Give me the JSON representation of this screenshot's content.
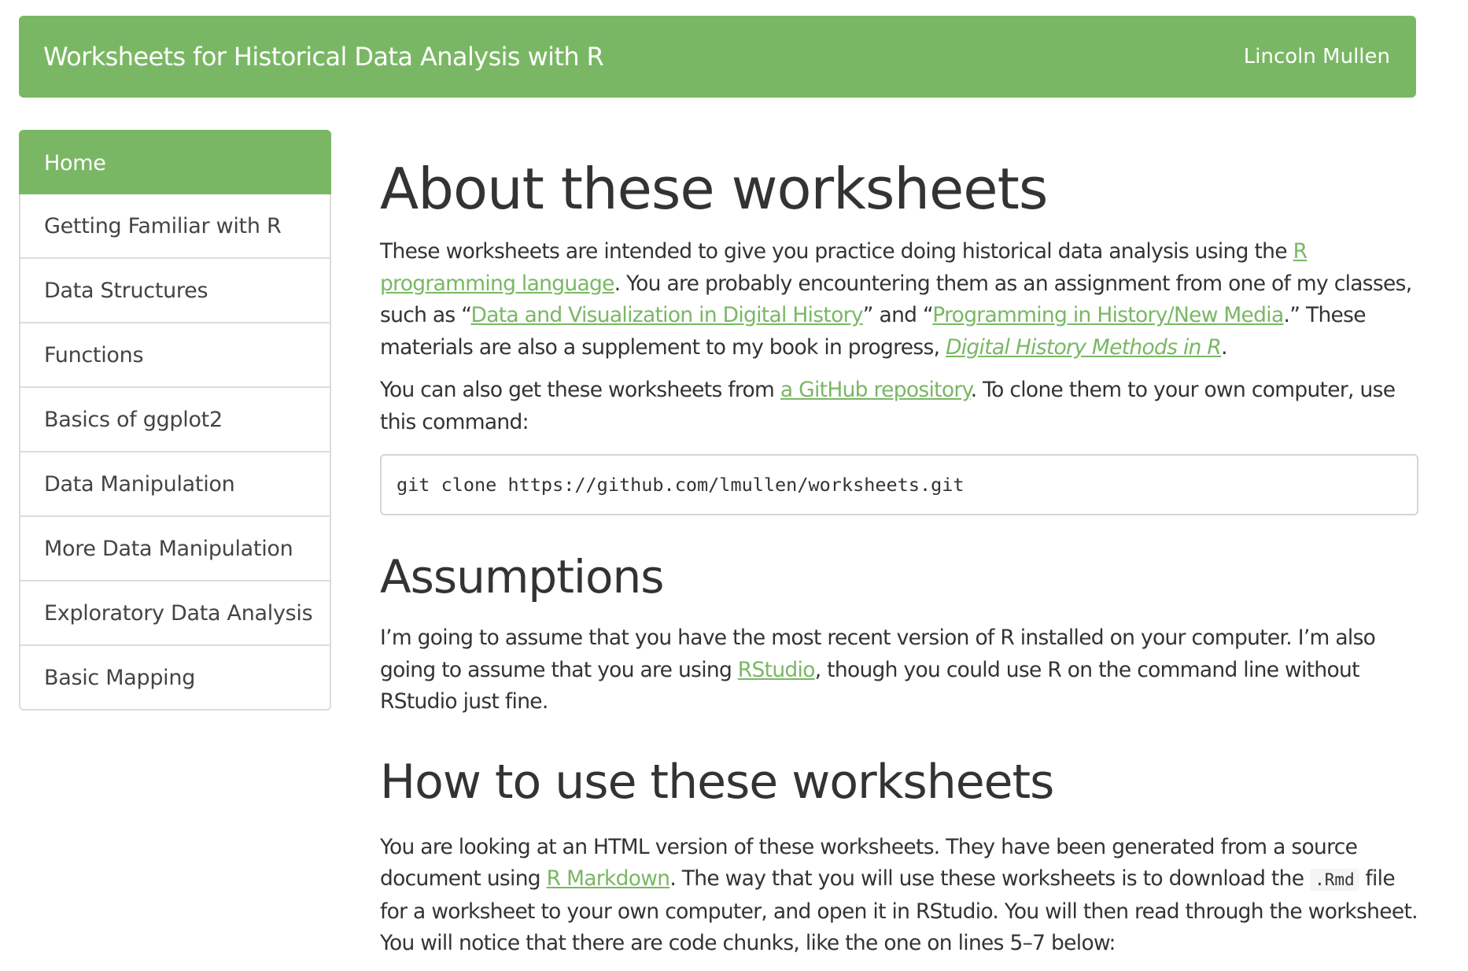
{
  "navbar": {
    "title": "Worksheets for Historical Data Analysis with R",
    "author": "Lincoln Mullen"
  },
  "sidebar": {
    "items": [
      {
        "label": "Home",
        "active": true
      },
      {
        "label": "Getting Familiar with R"
      },
      {
        "label": "Data Structures"
      },
      {
        "label": "Functions"
      },
      {
        "label": "Basics of ggplot2"
      },
      {
        "label": "Data Manipulation"
      },
      {
        "label": "More Data Manipulation"
      },
      {
        "label": "Exploratory Data Analysis"
      },
      {
        "label": "Basic Mapping"
      }
    ]
  },
  "content": {
    "h_about": "About these worksheets",
    "p1": {
      "t1": "These worksheets are intended to give you practice doing historical data analysis using the ",
      "link_r": "R programming language",
      "t2": ". You are probably encountering them as an assignment from one of my classes, such as “",
      "link_dvdh": "Data and Visualization in Digital History",
      "t3": "” and “",
      "link_phnm": "Programming in History/New Media",
      "t4": ".” These materials are also a supplement to my book in progress, ",
      "link_book": "Digital History Methods in R",
      "t5": "."
    },
    "p2": {
      "t1": "You can also get these worksheets from ",
      "link_repo": "a GitHub repository",
      "t2": ". To clone them to your own computer, use this command:"
    },
    "code_clone": "git clone https://github.com/lmullen/worksheets.git",
    "h_assumptions": "Assumptions",
    "p3": {
      "t1": "I’m going to assume that you have the most recent version of R installed on your computer. I’m also going to assume that you are using ",
      "link_rstudio": "RStudio",
      "t2": ", though you could use R on the command line without RStudio just fine."
    },
    "h_howto": "How to use these worksheets",
    "p4": {
      "t1": "You are looking at an HTML version of these worksheets. They have been generated from a source document using ",
      "link_rmd": "R Markdown",
      "t2": ". The way that you will use these worksheets is to download the ",
      "code_rmd": ".Rmd",
      "t3": " file for a worksheet to your own computer, and open it in RStudio. You will then read through the worksheet. You will notice that there are code chunks, like the one on lines 5–7 below:"
    }
  }
}
